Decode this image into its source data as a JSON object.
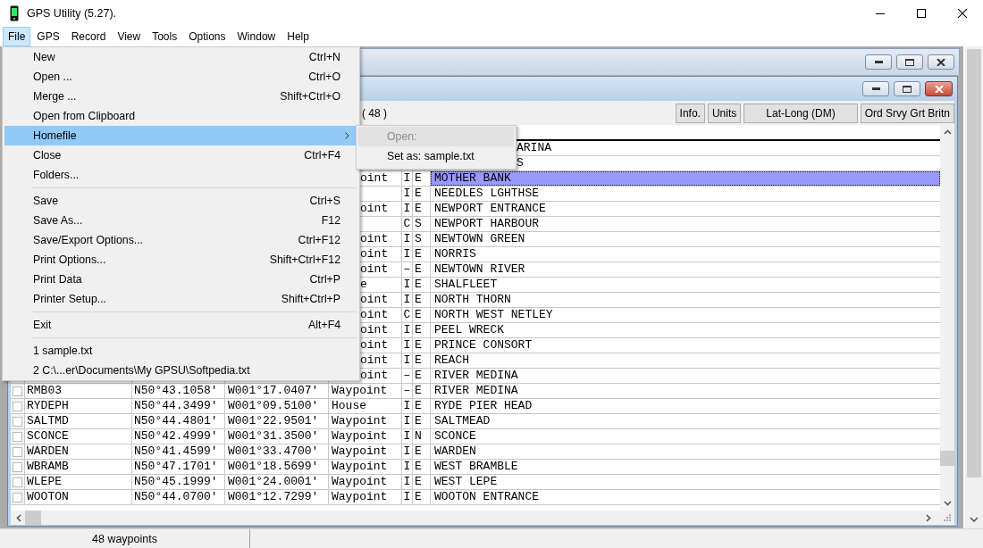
{
  "window": {
    "title": "GPS Utility (5.27)."
  },
  "menu_bar": [
    {
      "label": "File",
      "selected": true
    },
    {
      "label": "GPS",
      "selected": false
    },
    {
      "label": "Record",
      "selected": false
    },
    {
      "label": "View",
      "selected": false
    },
    {
      "label": "Tools",
      "selected": false
    },
    {
      "label": "Options",
      "selected": false
    },
    {
      "label": "Window",
      "selected": false
    },
    {
      "label": "Help",
      "selected": false
    }
  ],
  "file_menu": [
    {
      "kind": "item",
      "label": "New",
      "shortcut": "Ctrl+N",
      "selected": false,
      "submenu": false
    },
    {
      "kind": "item",
      "label": "Open ...",
      "shortcut": "Ctrl+O",
      "selected": false,
      "submenu": false
    },
    {
      "kind": "item",
      "label": "Merge ...",
      "shortcut": "Shift+Ctrl+O",
      "selected": false,
      "submenu": false
    },
    {
      "kind": "item",
      "label": "Open from Clipboard",
      "selected": false,
      "submenu": false
    },
    {
      "kind": "item",
      "label": "Homefile",
      "selected": true,
      "submenu": true
    },
    {
      "kind": "item",
      "label": "Close",
      "shortcut": "Ctrl+F4",
      "selected": false,
      "submenu": false
    },
    {
      "kind": "item",
      "label": "Folders...",
      "selected": false,
      "submenu": false
    },
    {
      "kind": "separator"
    },
    {
      "kind": "item",
      "label": "Save",
      "shortcut": "Ctrl+S",
      "selected": false,
      "submenu": false
    },
    {
      "kind": "item",
      "label": "Save As...",
      "shortcut": "F12",
      "selected": false,
      "submenu": false
    },
    {
      "kind": "item",
      "label": "Save/Export Options...",
      "shortcut": "Ctrl+F12",
      "selected": false,
      "submenu": false
    },
    {
      "kind": "item",
      "label": "Print Options...",
      "shortcut": "Shift+Ctrl+F12",
      "selected": false,
      "submenu": false
    },
    {
      "kind": "item",
      "label": "Print Data",
      "shortcut": "Ctrl+P",
      "selected": false,
      "submenu": false
    },
    {
      "kind": "item",
      "label": "Printer Setup...",
      "shortcut": "Shift+Ctrl+P",
      "selected": false,
      "submenu": false
    },
    {
      "kind": "separator"
    },
    {
      "kind": "item",
      "label": "Exit",
      "shortcut": "Alt+F4",
      "selected": false,
      "submenu": false
    },
    {
      "kind": "separator"
    },
    {
      "kind": "item",
      "label": "1 sample.txt",
      "selected": false,
      "submenu": false
    },
    {
      "kind": "item",
      "label": "2 C:\\...er\\Documents\\My GPSU\\Softpedia.txt",
      "selected": false,
      "submenu": false
    }
  ],
  "homefile_submenu": [
    {
      "label": "Open:",
      "disabled": true,
      "selected": true
    },
    {
      "label": "Set as: sample.txt",
      "disabled": false,
      "selected": false
    }
  ],
  "waypoint_window": {
    "count": "( 48 )",
    "buttons": [
      "Info.",
      "Units",
      "Lat-Long (DM)",
      "Ord Srvy Grt Britn"
    ],
    "rows": [
      {
        "kind": "under_submenu",
        "selected": false,
        "cells": [
          "ARINA"
        ]
      },
      {
        "kind": "under_submenu",
        "selected": false,
        "cells": [
          "S"
        ]
      },
      {
        "kind": "under_menu",
        "selected": true,
        "cells": [
          "oint",
          "I",
          "E",
          "MOTHER BANK"
        ]
      },
      {
        "kind": "under_menu",
        "selected": false,
        "cells": [
          null,
          "I",
          "E",
          "NEEDLES LGHTHSE"
        ]
      },
      {
        "kind": "under_menu",
        "selected": false,
        "cells": [
          "oint",
          "I",
          "E",
          "NEWPORT ENTRANCE"
        ]
      },
      {
        "kind": "under_menu",
        "selected": false,
        "cells": [
          null,
          "C",
          "S",
          "NEWPORT HARBOUR"
        ]
      },
      {
        "kind": "under_menu",
        "selected": false,
        "cells": [
          "oint",
          "I",
          "S",
          "NEWTOWN GREEN"
        ]
      },
      {
        "kind": "under_menu",
        "selected": false,
        "cells": [
          "oint",
          "I",
          "E",
          "NORRIS"
        ]
      },
      {
        "kind": "under_menu",
        "selected": false,
        "cells": [
          "oint",
          "–",
          "E",
          "NEWTOWN RIVER"
        ]
      },
      {
        "kind": "under_menu",
        "selected": false,
        "cells": [
          "e",
          "I",
          "E",
          "SHALFLEET"
        ]
      },
      {
        "kind": "under_menu",
        "selected": false,
        "cells": [
          "oint",
          "I",
          "E",
          "NORTH THORN"
        ]
      },
      {
        "kind": "under_menu",
        "selected": false,
        "cells": [
          "oint",
          "C",
          "E",
          "NORTH WEST NETLEY"
        ]
      },
      {
        "kind": "under_menu",
        "selected": false,
        "cells": [
          "oint",
          "I",
          "E",
          "PEEL WRECK"
        ]
      },
      {
        "kind": "under_menu",
        "selected": false,
        "cells": [
          "oint",
          "I",
          "E",
          "PRINCE CONSORT"
        ]
      },
      {
        "kind": "under_menu",
        "selected": false,
        "cells": [
          "oint",
          "I",
          "E",
          "REACH"
        ]
      },
      {
        "kind": "under_menu",
        "selected": false,
        "cells": [
          "oint",
          "–",
          "E",
          "RIVER MEDINA"
        ]
      },
      {
        "kind": "full",
        "selected": false,
        "checked": false,
        "cells": [
          "RMB03",
          "N50°43.1058'",
          "W001°17.0407'",
          "Waypoint",
          "–",
          "E",
          "RIVER MEDINA"
        ]
      },
      {
        "kind": "full",
        "selected": false,
        "checked": false,
        "cells": [
          "RYDEPH",
          "N50°44.3499'",
          "W001°09.5100'",
          "House",
          "I",
          "E",
          "RYDE PIER HEAD"
        ]
      },
      {
        "kind": "full",
        "selected": false,
        "checked": false,
        "cells": [
          "SALTMD",
          "N50°44.4801'",
          "W001°22.9501'",
          "Waypoint",
          "I",
          "E",
          "SALTMEAD"
        ]
      },
      {
        "kind": "full",
        "selected": false,
        "checked": false,
        "cells": [
          "SCONCE",
          "N50°42.4999'",
          "W001°31.3500'",
          "Waypoint",
          "I",
          "N",
          "SCONCE"
        ]
      },
      {
        "kind": "full",
        "selected": false,
        "checked": false,
        "cells": [
          "WARDEN",
          "N50°41.4599'",
          "W001°33.4700'",
          "Waypoint",
          "I",
          "E",
          "WARDEN"
        ]
      },
      {
        "kind": "full",
        "selected": false,
        "checked": false,
        "cells": [
          "WBRAMB",
          "N50°47.1701'",
          "W001°18.5699'",
          "Waypoint",
          "I",
          "E",
          "WEST BRAMBLE"
        ]
      },
      {
        "kind": "full",
        "selected": false,
        "checked": false,
        "cells": [
          "WLEPE",
          "N50°45.1999'",
          "W001°24.0001'",
          "Waypoint",
          "I",
          "E",
          "WEST LEPE"
        ]
      },
      {
        "kind": "full",
        "selected": false,
        "checked": false,
        "cells": [
          "WOOTON",
          "N50°44.0700'",
          "W001°12.7299'",
          "Waypoint",
          "I",
          "E",
          "WOOTON ENTRANCE"
        ]
      }
    ]
  },
  "status_bar": {
    "text": "48 waypoints"
  }
}
